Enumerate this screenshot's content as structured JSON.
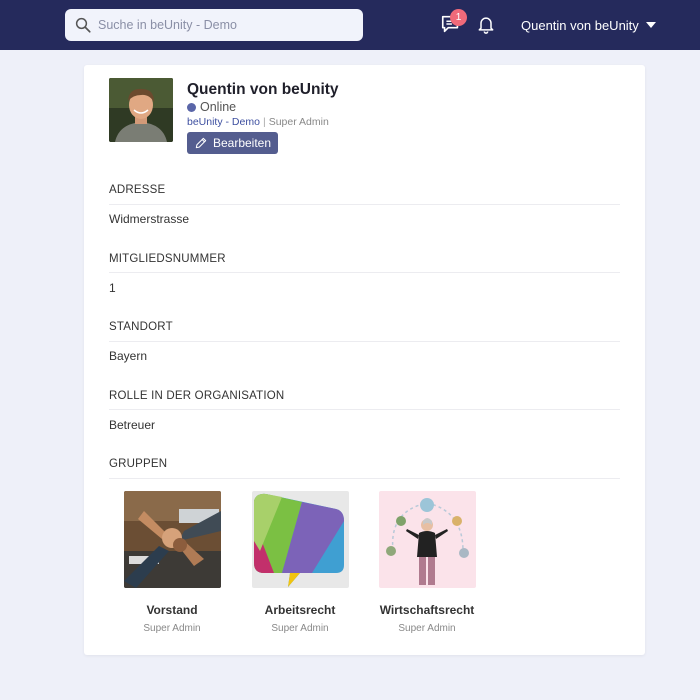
{
  "header": {
    "search_placeholder": "Suche in beUnity - Demo",
    "chat_badge": "1",
    "user_menu_label": "Quentin von beUnity"
  },
  "profile": {
    "name": "Quentin von beUnity",
    "status": "Online",
    "organization": "beUnity - Demo",
    "separator": "|",
    "role": "Super Admin",
    "edit_label": "Bearbeiten"
  },
  "sections": [
    {
      "label": "ADRESSE",
      "value": "Widmerstrasse"
    },
    {
      "label": "MITGLIEDSNUMMER",
      "value": "1"
    },
    {
      "label": "STANDORT",
      "value": "Bayern"
    },
    {
      "label": "ROLLE IN DER ORGANISATION",
      "value": "Betreuer"
    }
  ],
  "groups_label": "GRUPPEN",
  "groups": [
    {
      "name": "Vorstand",
      "role": "Super Admin"
    },
    {
      "name": "Arbeitsrecht",
      "role": "Super Admin"
    },
    {
      "name": "Wirtschaftsrecht",
      "role": "Super Admin"
    }
  ],
  "colors": {
    "topbar": "#252a5c",
    "accent": "#545d8f",
    "badge": "#f06a7a",
    "link": "#3d4fa0"
  }
}
